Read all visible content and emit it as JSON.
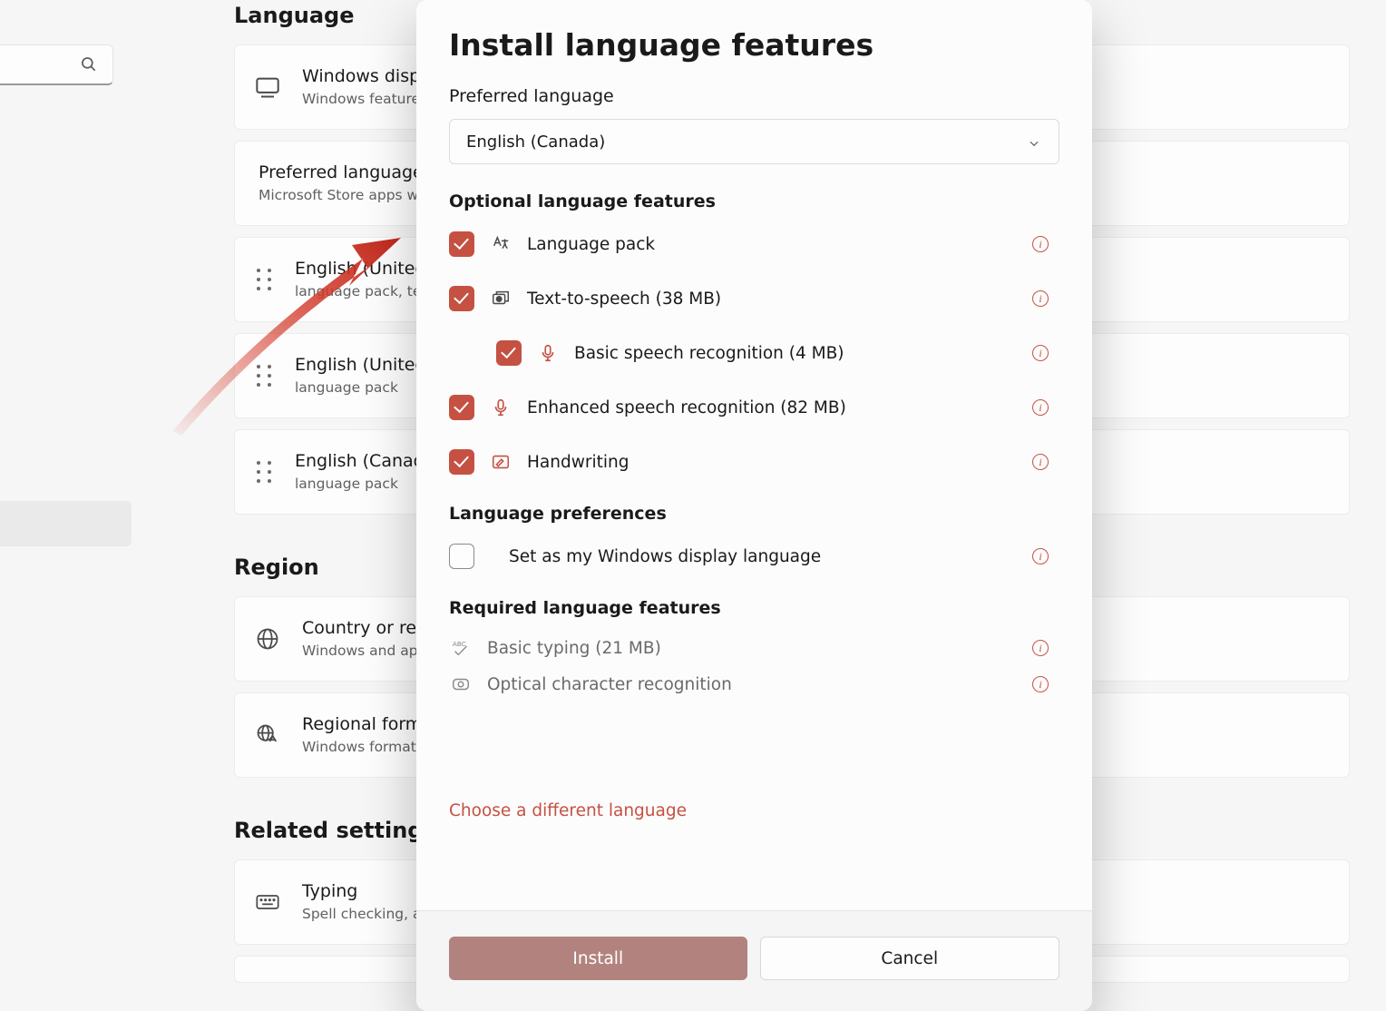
{
  "bg": {
    "section_language": "Language",
    "section_region": "Region",
    "section_related": "Related settings",
    "cards": {
      "display": {
        "title": "Windows display language",
        "subtitle": "Windows features like Settings and File Explorer will appear in this language"
      },
      "preferred": {
        "title": "Preferred languages",
        "subtitle": "Microsoft Store apps will appear in the first supported language in this list"
      },
      "lang1": {
        "title": "English (United States)",
        "subtitle": "language pack, text-to-speech, speech recognition, handwriting"
      },
      "lang2": {
        "title": "English (United Kingdom)",
        "subtitle": "language pack"
      },
      "lang3": {
        "title": "English (Canada)",
        "subtitle": "language pack"
      },
      "country": {
        "title": "Country or region",
        "subtitle": "Windows and apps might use your country or region to give you local content"
      },
      "regional": {
        "title": "Regional format",
        "subtitle": "Windows formats dates and times based on your regional format"
      },
      "typing": {
        "title": "Typing",
        "subtitle": "Spell checking, autocorrect suggestions"
      }
    }
  },
  "modal": {
    "title": "Install language features",
    "preferred_label": "Preferred language",
    "dropdown_value": "English (Canada)",
    "group_optional": "Optional language features",
    "group_prefs": "Language preferences",
    "group_required": "Required language features",
    "features": {
      "lang_pack": "Language pack",
      "tts": "Text-to-speech (38 MB)",
      "basic_speech": "Basic speech recognition (4 MB)",
      "enhanced_speech": "Enhanced speech recognition (82 MB)",
      "handwriting": "Handwriting",
      "set_display": "Set as my Windows display language",
      "basic_typing": "Basic typing (21 MB)",
      "ocr": "Optical character recognition"
    },
    "link": "Choose a different language",
    "install": "Install",
    "cancel": "Cancel"
  }
}
